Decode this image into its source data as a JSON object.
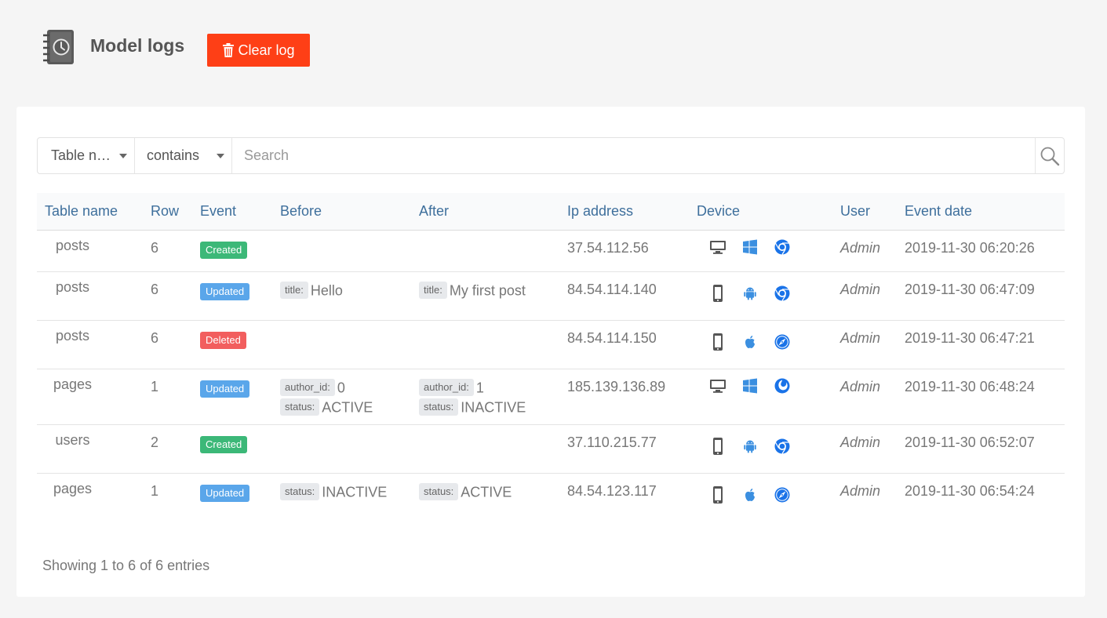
{
  "header": {
    "title": "Model logs",
    "clear_label": "Clear log"
  },
  "filter": {
    "column_selected": "Table n…",
    "operator_selected": "contains",
    "search_placeholder": "Search",
    "search_value": ""
  },
  "table": {
    "columns": [
      "Table name",
      "Row",
      "Event",
      "Before",
      "After",
      "Ip address",
      "Device",
      "User",
      "Event date"
    ],
    "rows": [
      {
        "table_name": "posts",
        "row": "6",
        "event": "Created",
        "before": [],
        "after": [],
        "ip": "37.54.112.56",
        "device": {
          "type": "desktop",
          "os": "windows",
          "browser": "chrome"
        },
        "user": "Admin",
        "date": "2019-11-30 06:20:26"
      },
      {
        "table_name": "posts",
        "row": "6",
        "event": "Updated",
        "before": [
          {
            "key": "title:",
            "value": "Hello"
          }
        ],
        "after": [
          {
            "key": "title:",
            "value": "My first post"
          }
        ],
        "ip": "84.54.114.140",
        "device": {
          "type": "mobile",
          "os": "android",
          "browser": "chrome"
        },
        "user": "Admin",
        "date": "2019-11-30 06:47:09"
      },
      {
        "table_name": "posts",
        "row": "6",
        "event": "Deleted",
        "before": [],
        "after": [],
        "ip": "84.54.114.150",
        "device": {
          "type": "mobile",
          "os": "apple",
          "browser": "safari"
        },
        "user": "Admin",
        "date": "2019-11-30 06:47:21"
      },
      {
        "table_name": "pages",
        "row": "1",
        "event": "Updated",
        "before": [
          {
            "key": "author_id:",
            "value": "0"
          },
          {
            "key": "status:",
            "value": "ACTIVE"
          }
        ],
        "after": [
          {
            "key": "author_id:",
            "value": "1"
          },
          {
            "key": "status:",
            "value": "INACTIVE"
          }
        ],
        "ip": "185.139.136.89",
        "device": {
          "type": "desktop",
          "os": "windows",
          "browser": "firefox"
        },
        "user": "Admin",
        "date": "2019-11-30 06:48:24"
      },
      {
        "table_name": "users",
        "row": "2",
        "event": "Created",
        "before": [],
        "after": [],
        "ip": "37.110.215.77",
        "device": {
          "type": "mobile",
          "os": "android",
          "browser": "chrome"
        },
        "user": "Admin",
        "date": "2019-11-30 06:52:07"
      },
      {
        "table_name": "pages",
        "row": "1",
        "event": "Updated",
        "before": [
          {
            "key": "status:",
            "value": "INACTIVE"
          }
        ],
        "after": [
          {
            "key": "status:",
            "value": "ACTIVE"
          }
        ],
        "ip": "84.54.123.117",
        "device": {
          "type": "mobile",
          "os": "apple",
          "browser": "safari"
        },
        "user": "Admin",
        "date": "2019-11-30 06:54:24"
      }
    ]
  },
  "footer": {
    "info": "Showing 1 to 6 of 6 entries"
  },
  "colors": {
    "accent": "#fe3f16",
    "header_text": "#3e6f9c",
    "created": "#3cb878",
    "updated": "#5aa6ea",
    "deleted": "#f25e5e",
    "device_blue": "#1a73e8"
  },
  "icons": {
    "logo": "clock-book-icon",
    "clear": "trash-icon",
    "search": "search-icon"
  }
}
